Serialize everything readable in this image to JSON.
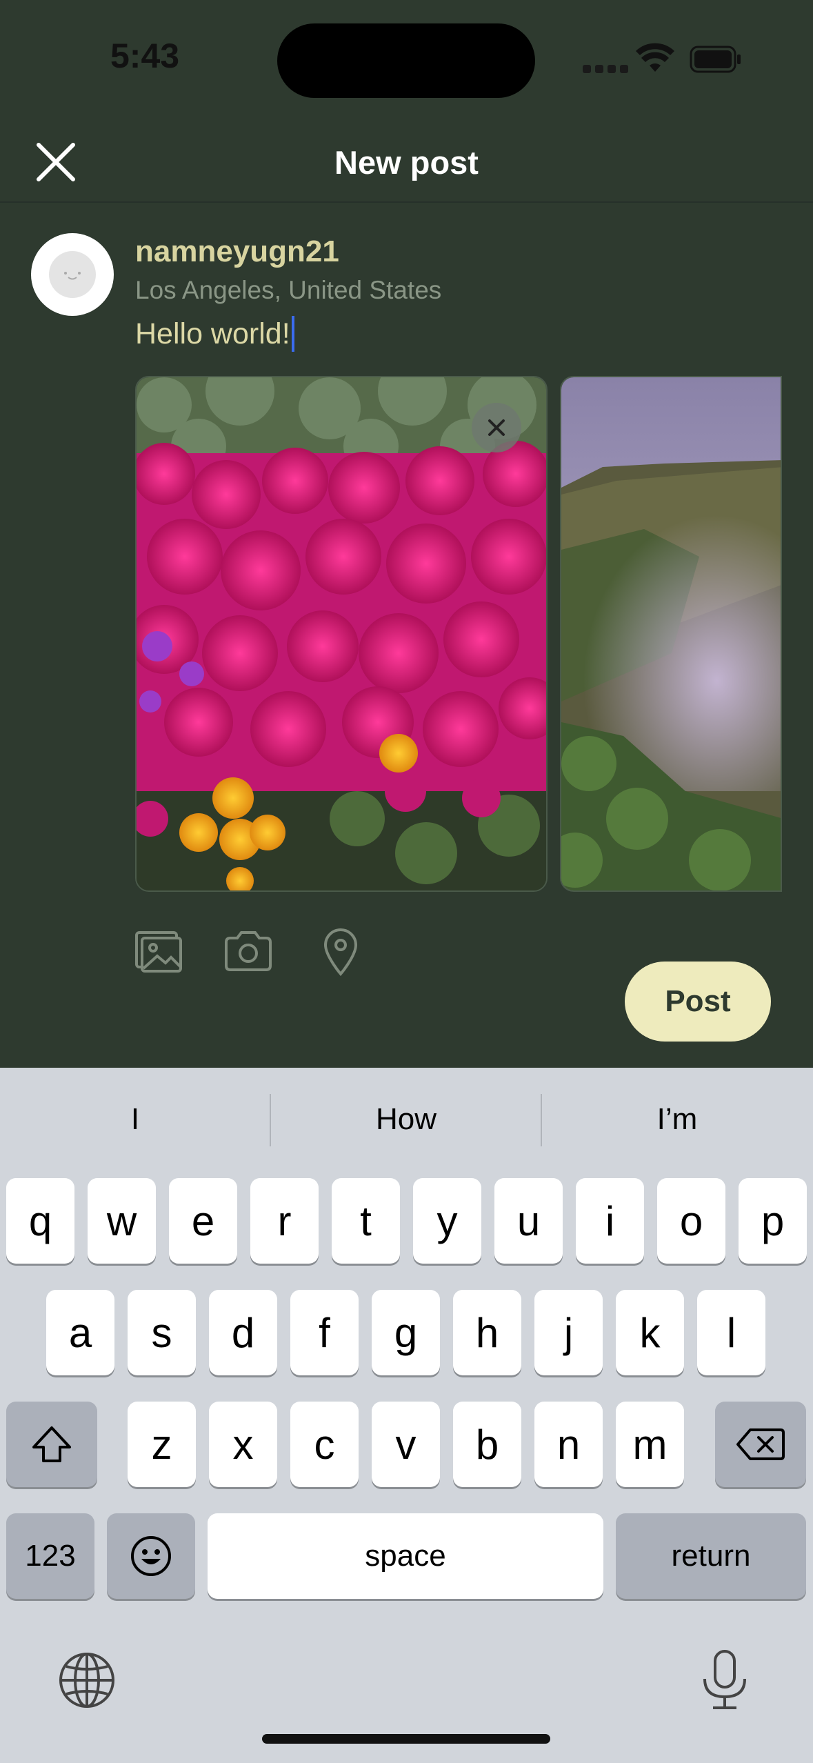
{
  "status_bar": {
    "time": "5:43"
  },
  "header": {
    "title": "New post"
  },
  "composer": {
    "username": "namneyugn21",
    "location": "Los Angeles, United States",
    "text": "Hello world!",
    "post_label": "Post"
  },
  "keyboard": {
    "suggestions": [
      "I",
      "How",
      "I’m"
    ],
    "row1": [
      "q",
      "w",
      "e",
      "r",
      "t",
      "y",
      "u",
      "i",
      "o",
      "p"
    ],
    "row2": [
      "a",
      "s",
      "d",
      "f",
      "g",
      "h",
      "j",
      "k",
      "l"
    ],
    "row3": [
      "z",
      "x",
      "c",
      "v",
      "b",
      "n",
      "m"
    ],
    "numbers_label": "123",
    "space_label": "space",
    "return_label": "return"
  },
  "colors": {
    "background": "#2e3a2f",
    "accent": "#eeebbd",
    "username": "#d8d4a0",
    "keyboard": "#d1d5db"
  },
  "icons": [
    "close-icon",
    "photo-gallery-icon",
    "camera-icon",
    "location-pin-icon",
    "shift-icon",
    "backspace-icon",
    "emoji-icon",
    "globe-icon",
    "microphone-icon"
  ]
}
